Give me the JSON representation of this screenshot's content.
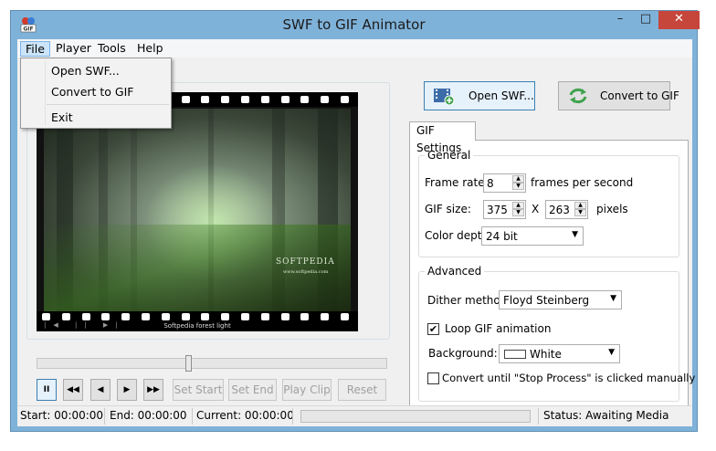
{
  "window": {
    "title": "SWF to GIF Animator",
    "icon_text": "GIF"
  },
  "menu": [
    {
      "label": "File"
    },
    {
      "label": "Player"
    },
    {
      "label": "Tools"
    },
    {
      "label": "Help"
    }
  ],
  "file_menu": {
    "open_swf": "Open SWF...",
    "convert_to_gif": "Convert to GIF",
    "exit": "Exit"
  },
  "preview": {
    "caption": "Softpedia forest light",
    "watermark": "SOFTPEDIA",
    "watermark_url": "www.softpedia.com",
    "controls": "|◀ || ▶|"
  },
  "transport": {
    "pause": "II",
    "rewind": "◀◀",
    "step_back": "◀",
    "step_forward": "▶",
    "fast_forward": "▶▶",
    "set_start": "Set Start",
    "set_end": "Set End",
    "play_clip": "Play Clip",
    "reset": "Reset",
    "seek_position": 0.43
  },
  "actions": {
    "open_swf": "Open SWF...",
    "convert_to_gif": "Convert to GIF"
  },
  "settings": {
    "tab": "GIF Settings",
    "general": {
      "title": "General",
      "frame_rate_label": "Frame rate:",
      "frame_rate": "8",
      "frame_rate_unit": "frames per second",
      "gif_size_label": "GIF size:",
      "width": "375",
      "x": "X",
      "height": "263",
      "size_unit": "pixels",
      "color_depth_label": "Color depth:",
      "color_depth": "24 bit"
    },
    "advanced": {
      "title": "Advanced",
      "dither_label": "Dither method:",
      "dither": "Floyd Steinberg",
      "loop_label": "Loop GIF animation",
      "loop_checked": true,
      "background_label": "Background:",
      "background": "White",
      "background_color": "#ffffff",
      "convert_until_label": "Convert until \"Stop Process\" is clicked manually",
      "convert_until_checked": false
    }
  },
  "status": {
    "start": "Start: 00:00:00",
    "end": "End: 00:00:00",
    "current": "Current: 00:00:00",
    "status": "Status: Awaiting Media"
  },
  "colors": {
    "accent": "#3c7fb1",
    "close": "#c7463b",
    "frame": "#7fb2d9"
  }
}
